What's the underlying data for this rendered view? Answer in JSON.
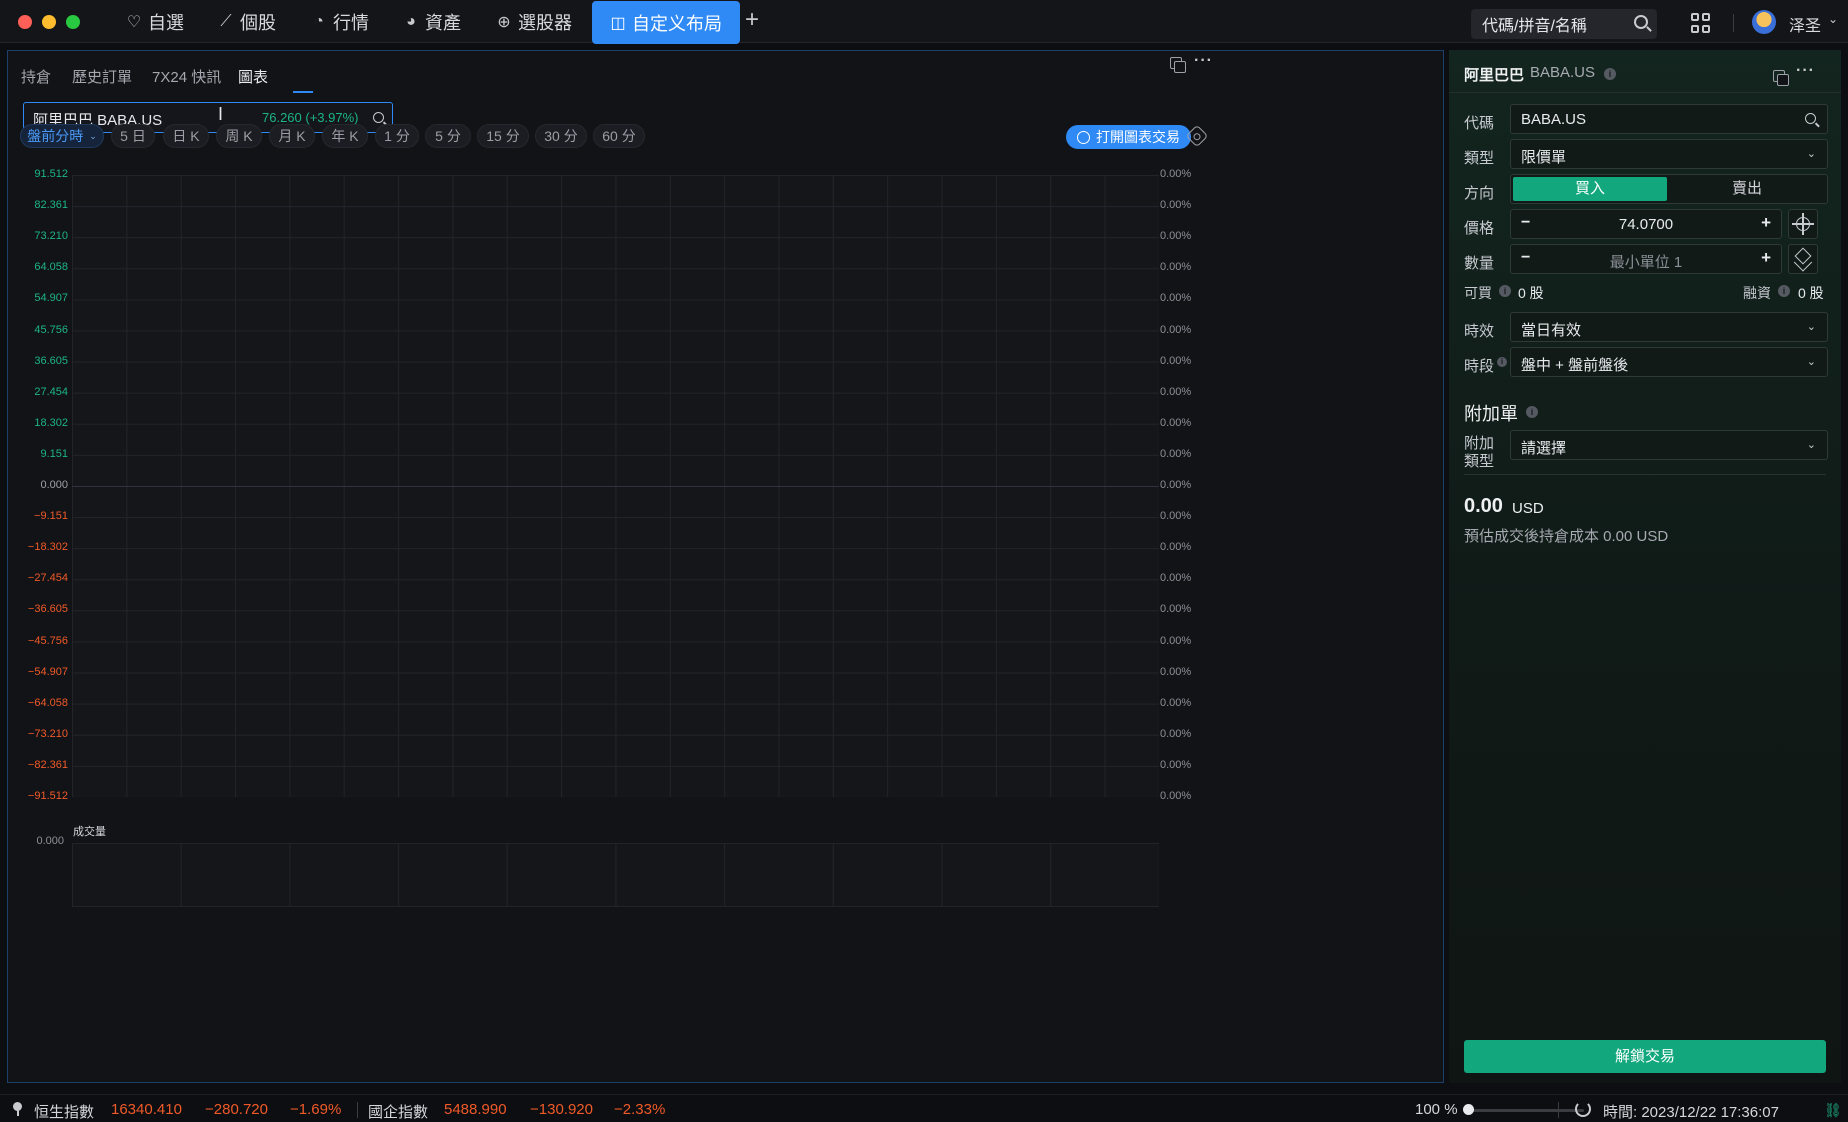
{
  "nav": {
    "tabs": [
      {
        "icon": "heart-icon",
        "label": "自選"
      },
      {
        "icon": "chart-line-icon",
        "label": "個股"
      },
      {
        "icon": "market-icon",
        "label": "行情"
      },
      {
        "icon": "pie-icon",
        "label": "資產"
      },
      {
        "icon": "screener-icon",
        "label": "選股器"
      },
      {
        "icon": "layout-icon",
        "label": "自定义布局",
        "active": true
      }
    ],
    "search_placeholder": "代碼/拼音/名稱",
    "user_name": "泽圣"
  },
  "main": {
    "tabs": [
      "持倉",
      "歷史訂單",
      "7X24 快訊",
      "圖表"
    ],
    "active_tab": "圖表",
    "stock_name": "阿里巴巴 BABA.US",
    "stock_price": "76.260 (+3.97%)",
    "periods": [
      "盤前分時",
      "5 日",
      "日 K",
      "周 K",
      "月 K",
      "年 K",
      "1 分",
      "5 分",
      "15 分",
      "30 分",
      "60 分"
    ],
    "active_period": "盤前分時",
    "open_trade_label": "打開圖表交易"
  },
  "chart_data": {
    "type": "line",
    "title": "",
    "y_ticks": [
      "91.512",
      "82.361",
      "73.210",
      "64.058",
      "54.907",
      "45.756",
      "36.605",
      "27.454",
      "18.302",
      "9.151",
      "0.000",
      "−9.151",
      "−18.302",
      "−27.454",
      "−36.605",
      "−45.756",
      "−54.907",
      "−64.058",
      "−73.210",
      "−82.361",
      "−91.512"
    ],
    "right_ticks": [
      "0.00%",
      "0.00%",
      "0.00%",
      "0.00%",
      "0.00%",
      "0.00%",
      "0.00%",
      "0.00%",
      "0.00%",
      "0.00%",
      "0.00%",
      "0.00%",
      "0.00%",
      "0.00%",
      "0.00%",
      "0.00%",
      "0.00%",
      "0.00%",
      "0.00%",
      "0.00%",
      "0.00%"
    ],
    "ylim": [
      -91.512,
      91.512
    ],
    "series": [],
    "grid": true,
    "volume": {
      "title": "成交量",
      "y_ticks": [
        "0.000"
      ]
    }
  },
  "trade": {
    "name": "阿里巴巴",
    "code": "BABA.US",
    "labels": {
      "code": "代碼",
      "type": "類型",
      "direction": "方向",
      "price": "價格",
      "quantity": "數量",
      "buyable": "可買",
      "margin": "融資",
      "validity": "時效",
      "session": "時段",
      "attach_title": "附加單",
      "attach_type_1": "附加",
      "attach_type_2": "類型"
    },
    "code_value": "BABA.US",
    "type_value": "限價單",
    "buy_label": "買入",
    "sell_label": "賣出",
    "price_value": "74.0700",
    "quantity_placeholder": "最小單位 1",
    "buyable_value": "0 股",
    "margin_value": "0 股",
    "validity_value": "當日有效",
    "session_value": "盤中 + 盤前盤後",
    "attach_value": "請選擇",
    "cost_amount": "0.00",
    "cost_currency": "USD",
    "cost_note": "預估成交後持倉成本 0.00 USD",
    "unlock_label": "解鎖交易",
    "accent_color": "#13a77d"
  },
  "status": {
    "index1_name": "恒生指數",
    "index1_value": "16340.410",
    "index1_change": "−280.720",
    "index1_pct": "−1.69%",
    "index2_name": "國企指數",
    "index2_value": "5488.990",
    "index2_change": "−130.920",
    "index2_pct": "−2.33%",
    "zoom": "100 %",
    "time": "時間: 2023/12/22 17:36:07"
  }
}
